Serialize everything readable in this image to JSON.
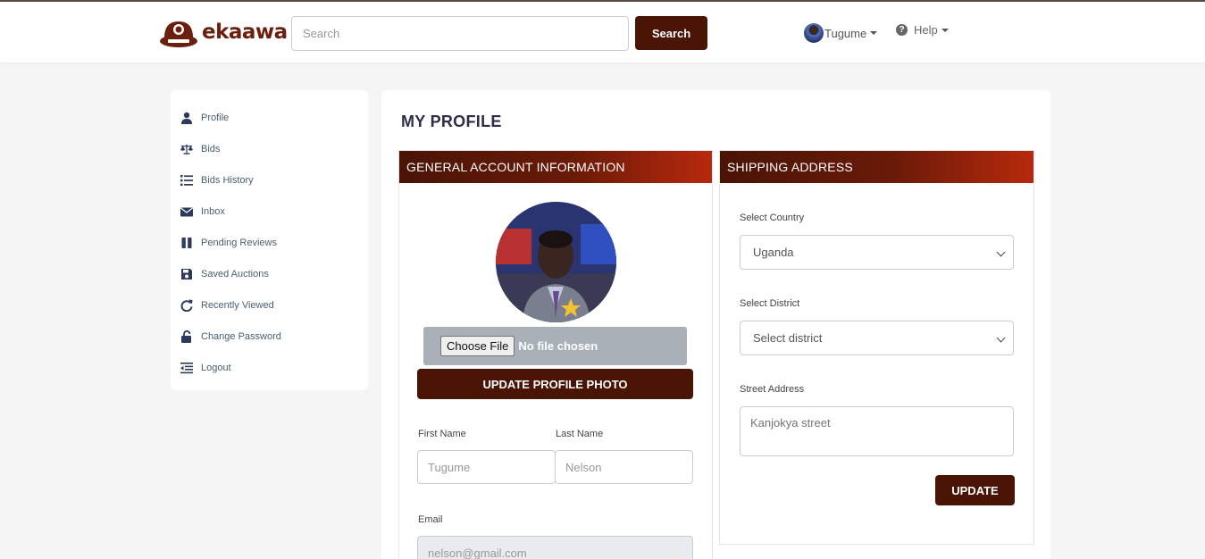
{
  "header": {
    "brand": "ekaawa",
    "search_placeholder": "Search",
    "search_button": "Search",
    "user_name": "Tugume",
    "help_label": "Help"
  },
  "sidebar": {
    "items": [
      {
        "label": "Profile",
        "icon": "user-icon"
      },
      {
        "label": "Bids",
        "icon": "scale-icon"
      },
      {
        "label": "Bids History",
        "icon": "list-icon"
      },
      {
        "label": "Inbox",
        "icon": "envelope-icon"
      },
      {
        "label": "Pending Reviews",
        "icon": "pause-icon"
      },
      {
        "label": "Saved Auctions",
        "icon": "save-icon"
      },
      {
        "label": "Recently Viewed",
        "icon": "redo-icon"
      },
      {
        "label": "Change Password",
        "icon": "unlock-icon"
      },
      {
        "label": "Logout",
        "icon": "outdent-icon"
      }
    ]
  },
  "main": {
    "page_title": "MY PROFILE",
    "general": {
      "heading": "GENERAL ACCOUNT INFORMATION",
      "choose_file": "Choose File",
      "file_status": "No file chosen",
      "update_photo": "UPDATE PROFILE PHOTO",
      "first_name_label": "First Name",
      "first_name_placeholder": "Tugume",
      "last_name_label": "Last Name",
      "last_name_placeholder": "Nelson",
      "email_label": "Email",
      "email_placeholder": "nelson@gmail.com"
    },
    "shipping": {
      "heading": "SHIPPING ADDRESS",
      "country_label": "Select Country",
      "country_value": "Uganda",
      "district_label": "Select District",
      "district_value": "Select district",
      "street_label": "Street Address",
      "street_placeholder": "Kanjokya street",
      "update_button": "UPDATE"
    }
  },
  "colors": {
    "brand_dark": "#4a1405",
    "brand_red": "#b8290c",
    "sidebar_icon": "#2d3a5a"
  }
}
